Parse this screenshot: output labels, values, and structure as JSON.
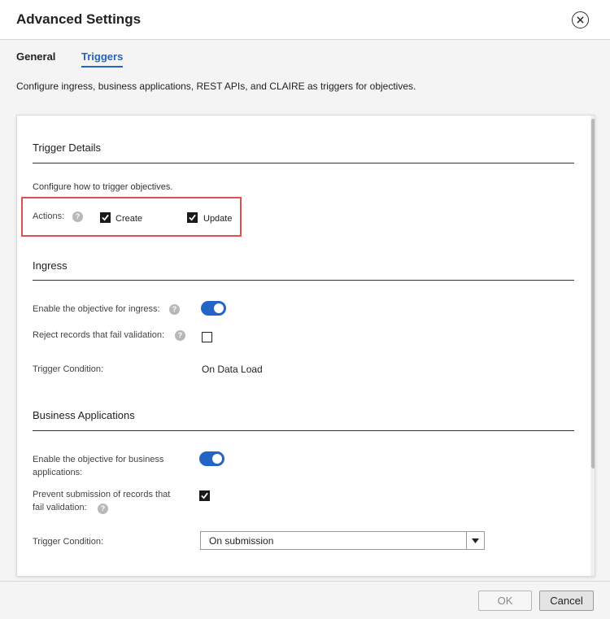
{
  "dialog": {
    "title": "Advanced Settings"
  },
  "tabs": [
    {
      "label": "General",
      "active": false
    },
    {
      "label": "Triggers",
      "active": true
    }
  ],
  "description": "Configure ingress, business applications, REST APIs, and CLAIRE as triggers for objectives.",
  "trigger_details": {
    "title": "Trigger Details",
    "subtitle": "Configure how to trigger objectives.",
    "actions_label": "Actions:",
    "create_label": "Create",
    "create_checked": true,
    "update_label": "Update",
    "update_checked": true
  },
  "ingress": {
    "title": "Ingress",
    "enable_label": "Enable the objective for ingress:",
    "enable_on": true,
    "reject_label": "Reject records that fail validation:",
    "reject_checked": false,
    "condition_label": "Trigger Condition:",
    "condition_value": "On Data Load"
  },
  "business_applications": {
    "title": "Business Applications",
    "enable_label": "Enable the objective for business applications:",
    "enable_on": true,
    "prevent_label": "Prevent submission of records that fail validation:",
    "prevent_checked": true,
    "condition_label": "Trigger Condition:",
    "condition_value": "On submission"
  },
  "footer": {
    "ok_label": "OK",
    "cancel_label": "Cancel"
  },
  "icons": {
    "help": "?",
    "close": "close-icon",
    "dropdown": "caret-down-icon"
  },
  "colors": {
    "accent": "#2563c7",
    "highlight": "#e05050"
  }
}
